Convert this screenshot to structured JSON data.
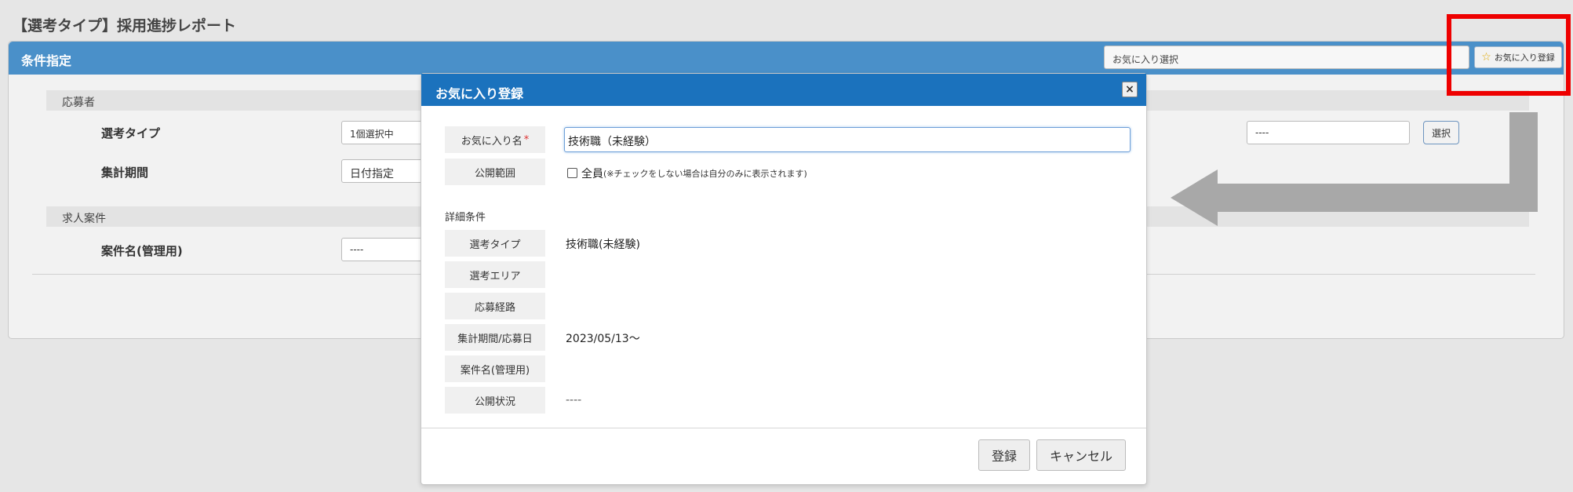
{
  "page_title": "【選考タイプ】採用進捗レポート",
  "panel": {
    "title": "条件指定",
    "favorite_select_value": "お気に入り選択",
    "favorite_register_label": "お気に入り登録",
    "sections": {
      "applicant": "応募者",
      "job": "求人案件"
    },
    "fields": {
      "selection_type_label": "選考タイプ",
      "selection_type_value": "1個選択中",
      "period_label": "集計期間",
      "period_value": "日付指定",
      "job_name_label": "案件名(管理用)",
      "job_name_value": "----",
      "right_field_value": "----",
      "select_button": "選択"
    }
  },
  "modal": {
    "title": "お気に入り登録",
    "close_icon": "×",
    "name_label": "お気に入り名",
    "required_mark": "*",
    "name_value": "技術職（未経験）",
    "scope_label": "公開範囲",
    "scope_checkbox_label": "全員",
    "scope_note": "(※チェックをしない場合は自分のみに表示されます)",
    "scope_checked": false,
    "details_heading": "詳細条件",
    "details": [
      {
        "label": "選考タイプ",
        "value": "技術職(未経験)"
      },
      {
        "label": "選考エリア",
        "value": ""
      },
      {
        "label": "応募経路",
        "value": ""
      },
      {
        "label": "集計期間/応募日",
        "value": "2023/05/13〜"
      },
      {
        "label": "案件名(管理用)",
        "value": ""
      },
      {
        "label": "公開状況",
        "value": "----"
      }
    ],
    "buttons": {
      "register": "登録",
      "cancel": "キャンセル"
    }
  },
  "colors": {
    "panel_header": "#4a90c9",
    "modal_header": "#1b72bd",
    "highlight_box": "#ee0000",
    "arrow": "#a8a8a8"
  }
}
